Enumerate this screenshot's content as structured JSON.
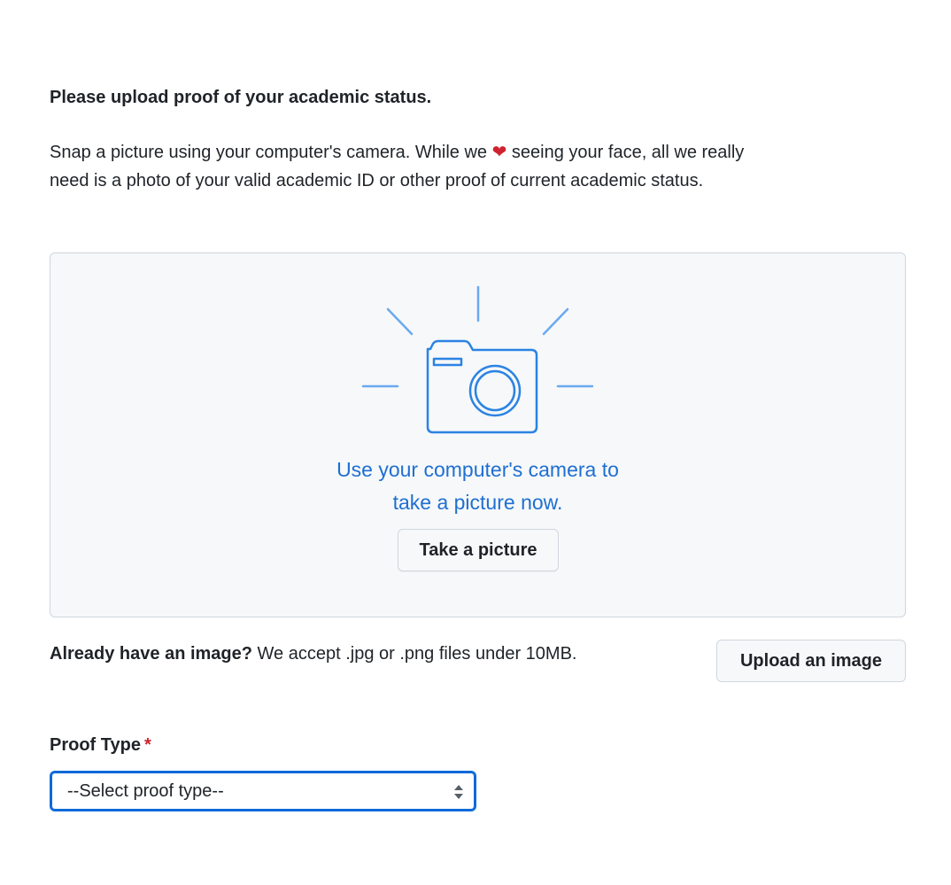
{
  "heading": "Please upload proof of your academic status.",
  "intro": {
    "before_heart": "Snap a picture using your computer's camera. While we ",
    "heart": "❤",
    "after_heart": " seeing your face, all we really need is a photo of your valid academic ID or other proof of current academic status."
  },
  "capture": {
    "line1": "Use your computer's camera to",
    "line2": "take a picture now.",
    "button_label": "Take a picture",
    "icon": "camera-icon"
  },
  "upload": {
    "prompt_strong": "Already have an image?",
    "prompt_rest": " We accept .jpg or .png files under 10MB.",
    "button_label": "Upload an image"
  },
  "proof_type": {
    "label": "Proof Type",
    "required_mark": "*",
    "selected": "--Select proof type--"
  },
  "colors": {
    "accent": "#1f6fd1",
    "focus_border": "#0969da",
    "required": "#cf222e",
    "panel_bg": "#f6f8fa"
  }
}
